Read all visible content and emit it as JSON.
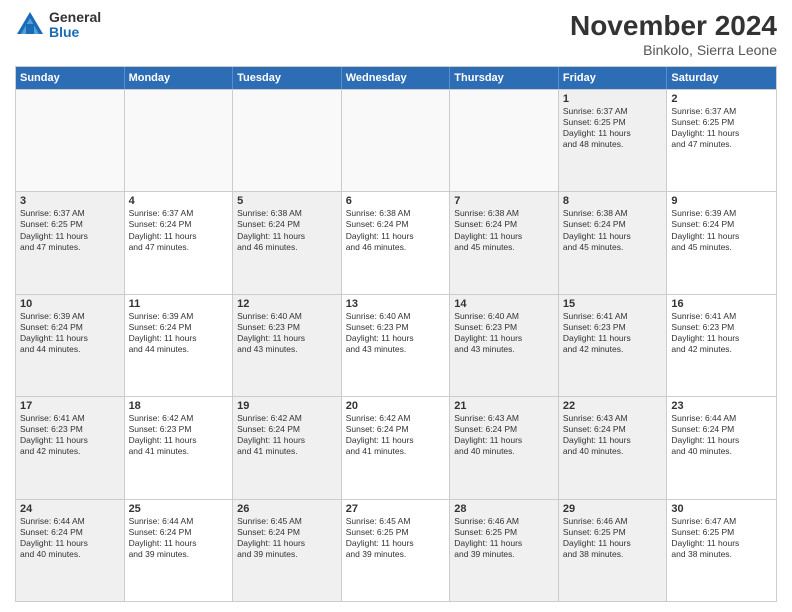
{
  "logo": {
    "general": "General",
    "blue": "Blue"
  },
  "title": {
    "month": "November 2024",
    "location": "Binkolo, Sierra Leone"
  },
  "calendar": {
    "headers": [
      "Sunday",
      "Monday",
      "Tuesday",
      "Wednesday",
      "Thursday",
      "Friday",
      "Saturday"
    ],
    "rows": [
      [
        {
          "day": "",
          "info": "",
          "empty": true
        },
        {
          "day": "",
          "info": "",
          "empty": true
        },
        {
          "day": "",
          "info": "",
          "empty": true
        },
        {
          "day": "",
          "info": "",
          "empty": true
        },
        {
          "day": "",
          "info": "",
          "empty": true
        },
        {
          "day": "1",
          "info": "Sunrise: 6:37 AM\nSunset: 6:25 PM\nDaylight: 11 hours\nand 48 minutes.",
          "empty": false,
          "shaded": true
        },
        {
          "day": "2",
          "info": "Sunrise: 6:37 AM\nSunset: 6:25 PM\nDaylight: 11 hours\nand 47 minutes.",
          "empty": false,
          "shaded": false
        }
      ],
      [
        {
          "day": "3",
          "info": "Sunrise: 6:37 AM\nSunset: 6:25 PM\nDaylight: 11 hours\nand 47 minutes.",
          "empty": false,
          "shaded": true
        },
        {
          "day": "4",
          "info": "Sunrise: 6:37 AM\nSunset: 6:24 PM\nDaylight: 11 hours\nand 47 minutes.",
          "empty": false,
          "shaded": false
        },
        {
          "day": "5",
          "info": "Sunrise: 6:38 AM\nSunset: 6:24 PM\nDaylight: 11 hours\nand 46 minutes.",
          "empty": false,
          "shaded": true
        },
        {
          "day": "6",
          "info": "Sunrise: 6:38 AM\nSunset: 6:24 PM\nDaylight: 11 hours\nand 46 minutes.",
          "empty": false,
          "shaded": false
        },
        {
          "day": "7",
          "info": "Sunrise: 6:38 AM\nSunset: 6:24 PM\nDaylight: 11 hours\nand 45 minutes.",
          "empty": false,
          "shaded": true
        },
        {
          "day": "8",
          "info": "Sunrise: 6:38 AM\nSunset: 6:24 PM\nDaylight: 11 hours\nand 45 minutes.",
          "empty": false,
          "shaded": true
        },
        {
          "day": "9",
          "info": "Sunrise: 6:39 AM\nSunset: 6:24 PM\nDaylight: 11 hours\nand 45 minutes.",
          "empty": false,
          "shaded": false
        }
      ],
      [
        {
          "day": "10",
          "info": "Sunrise: 6:39 AM\nSunset: 6:24 PM\nDaylight: 11 hours\nand 44 minutes.",
          "empty": false,
          "shaded": true
        },
        {
          "day": "11",
          "info": "Sunrise: 6:39 AM\nSunset: 6:24 PM\nDaylight: 11 hours\nand 44 minutes.",
          "empty": false,
          "shaded": false
        },
        {
          "day": "12",
          "info": "Sunrise: 6:40 AM\nSunset: 6:23 PM\nDaylight: 11 hours\nand 43 minutes.",
          "empty": false,
          "shaded": true
        },
        {
          "day": "13",
          "info": "Sunrise: 6:40 AM\nSunset: 6:23 PM\nDaylight: 11 hours\nand 43 minutes.",
          "empty": false,
          "shaded": false
        },
        {
          "day": "14",
          "info": "Sunrise: 6:40 AM\nSunset: 6:23 PM\nDaylight: 11 hours\nand 43 minutes.",
          "empty": false,
          "shaded": true
        },
        {
          "day": "15",
          "info": "Sunrise: 6:41 AM\nSunset: 6:23 PM\nDaylight: 11 hours\nand 42 minutes.",
          "empty": false,
          "shaded": true
        },
        {
          "day": "16",
          "info": "Sunrise: 6:41 AM\nSunset: 6:23 PM\nDaylight: 11 hours\nand 42 minutes.",
          "empty": false,
          "shaded": false
        }
      ],
      [
        {
          "day": "17",
          "info": "Sunrise: 6:41 AM\nSunset: 6:23 PM\nDaylight: 11 hours\nand 42 minutes.",
          "empty": false,
          "shaded": true
        },
        {
          "day": "18",
          "info": "Sunrise: 6:42 AM\nSunset: 6:23 PM\nDaylight: 11 hours\nand 41 minutes.",
          "empty": false,
          "shaded": false
        },
        {
          "day": "19",
          "info": "Sunrise: 6:42 AM\nSunset: 6:24 PM\nDaylight: 11 hours\nand 41 minutes.",
          "empty": false,
          "shaded": true
        },
        {
          "day": "20",
          "info": "Sunrise: 6:42 AM\nSunset: 6:24 PM\nDaylight: 11 hours\nand 41 minutes.",
          "empty": false,
          "shaded": false
        },
        {
          "day": "21",
          "info": "Sunrise: 6:43 AM\nSunset: 6:24 PM\nDaylight: 11 hours\nand 40 minutes.",
          "empty": false,
          "shaded": true
        },
        {
          "day": "22",
          "info": "Sunrise: 6:43 AM\nSunset: 6:24 PM\nDaylight: 11 hours\nand 40 minutes.",
          "empty": false,
          "shaded": true
        },
        {
          "day": "23",
          "info": "Sunrise: 6:44 AM\nSunset: 6:24 PM\nDaylight: 11 hours\nand 40 minutes.",
          "empty": false,
          "shaded": false
        }
      ],
      [
        {
          "day": "24",
          "info": "Sunrise: 6:44 AM\nSunset: 6:24 PM\nDaylight: 11 hours\nand 40 minutes.",
          "empty": false,
          "shaded": true
        },
        {
          "day": "25",
          "info": "Sunrise: 6:44 AM\nSunset: 6:24 PM\nDaylight: 11 hours\nand 39 minutes.",
          "empty": false,
          "shaded": false
        },
        {
          "day": "26",
          "info": "Sunrise: 6:45 AM\nSunset: 6:24 PM\nDaylight: 11 hours\nand 39 minutes.",
          "empty": false,
          "shaded": true
        },
        {
          "day": "27",
          "info": "Sunrise: 6:45 AM\nSunset: 6:25 PM\nDaylight: 11 hours\nand 39 minutes.",
          "empty": false,
          "shaded": false
        },
        {
          "day": "28",
          "info": "Sunrise: 6:46 AM\nSunset: 6:25 PM\nDaylight: 11 hours\nand 39 minutes.",
          "empty": false,
          "shaded": true
        },
        {
          "day": "29",
          "info": "Sunrise: 6:46 AM\nSunset: 6:25 PM\nDaylight: 11 hours\nand 38 minutes.",
          "empty": false,
          "shaded": true
        },
        {
          "day": "30",
          "info": "Sunrise: 6:47 AM\nSunset: 6:25 PM\nDaylight: 11 hours\nand 38 minutes.",
          "empty": false,
          "shaded": false
        }
      ]
    ]
  }
}
